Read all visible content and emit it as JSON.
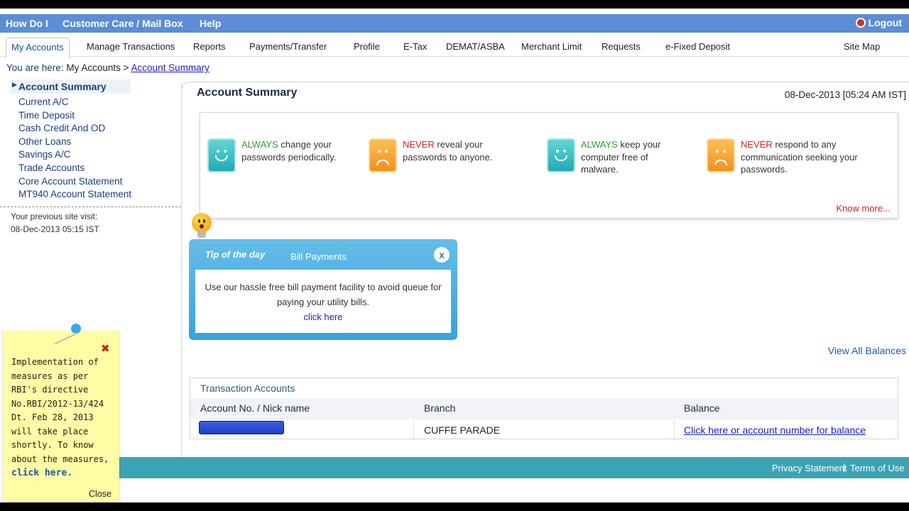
{
  "topbar": {
    "how_do_i": "How Do I",
    "customer_care": "Customer Care / Mail Box",
    "help": "Help",
    "logout": "Logout"
  },
  "menu": {
    "items": [
      "My Accounts",
      "Manage Transactions",
      "Reports",
      "Payments/Transfer",
      "Profile",
      "E-Tax",
      "DEMAT/ASBA",
      "Merchant Limit",
      "Requests",
      "e-Fixed Deposit"
    ],
    "site_map": "Site Map"
  },
  "breadcrumb": {
    "prefix": "You are here:",
    "parent": "My Accounts",
    "sep": ">",
    "current": "Account Summary"
  },
  "sidebar": {
    "heading": "Account Summary",
    "items": [
      "Current A/C",
      "Time Deposit",
      "Cash Credit And OD",
      "Other Loans",
      "Savings A/C",
      "Trade Accounts",
      "Core Account Statement",
      "MT940 Account Statement"
    ],
    "prev_visit_label": "Your previous site visit:",
    "prev_visit_value": "08-Dec-2013 05:15 IST"
  },
  "main": {
    "title": "Account Summary",
    "datetime": "08-Dec-2013 [05:24 AM IST]"
  },
  "security": {
    "tips": [
      {
        "keyword": "ALWAYS",
        "rest": " change your passwords periodically.",
        "mood": "good"
      },
      {
        "keyword": "NEVER",
        "rest": " reveal your passwords to anyone.",
        "mood": "bad"
      },
      {
        "keyword": "ALWAYS",
        "rest": " keep your computer free of malware.",
        "mood": "good"
      },
      {
        "keyword": "NEVER",
        "rest": " respond to any communication seeking your passwords.",
        "mood": "bad"
      }
    ],
    "know_more": "Know more..."
  },
  "tip_of_day": {
    "label": "Tip of the day",
    "title": "Bill Payments",
    "close": "x",
    "body": "Use our hassle free bill payment facility to avoid queue for paying your utility bills.",
    "link": "click here"
  },
  "view_all_balances": "View All Balances",
  "transactions": {
    "caption": "Transaction Accounts",
    "headers": [
      "Account No. / Nick name",
      "Branch",
      "Balance"
    ],
    "rows": [
      {
        "account": "",
        "branch": "CUFFE PARADE",
        "balance": "Click here or account number for balance"
      }
    ]
  },
  "footer": {
    "privacy": "Privacy Statement",
    "sep": "|",
    "terms": "Terms of Use"
  },
  "notice": {
    "close_x": "✖",
    "text": "Implementation of measures as per RBI's directive No.RBI/2012-13/424 Dt. Feb 28, 2013 will take place shortly. To know about the measures,",
    "link": "click here.",
    "close": "Close"
  },
  "colors": {
    "topbar": "#5b8ed6",
    "footer": "#3ba4b4",
    "link": "#1a1ad0",
    "warning": "#d02020",
    "positive": "#2aa12a"
  }
}
